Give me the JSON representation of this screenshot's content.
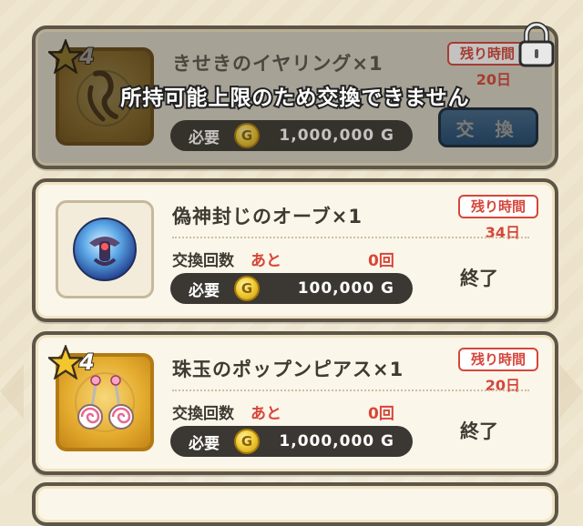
{
  "items": [
    {
      "name": "きせきのイヤリング×1",
      "rarity": "4",
      "time_label": "残り時間",
      "time_value": "20日",
      "need_label": "必要",
      "cost": "1,000,000 G",
      "button_label": "交 換",
      "locked": true,
      "lock_message": "所持可能上限のため交換できません"
    },
    {
      "name": "偽神封じのオーブ×1",
      "time_label": "残り時間",
      "time_value": "34日",
      "exchange_label": "交換回数",
      "remaining_label": "あと",
      "remaining_count": "0回",
      "need_label": "必要",
      "cost": "100,000 G",
      "status": "終了"
    },
    {
      "name": "珠玉のポップンピアス×1",
      "rarity": "4",
      "time_label": "残り時間",
      "time_value": "20日",
      "exchange_label": "交換回数",
      "remaining_label": "あと",
      "remaining_count": "0回",
      "need_label": "必要",
      "cost": "1,000,000 G",
      "status": "終了"
    }
  ],
  "coin_symbol": "G",
  "colors": {
    "accent_red": "#d6463a",
    "pill": "#3b3833",
    "button_blue": "#3274b8"
  },
  "icons": [
    "star-icon",
    "earring-icon",
    "orb-icon",
    "lollipop-earring-icon",
    "lock-icon",
    "gold-coin-icon"
  ]
}
